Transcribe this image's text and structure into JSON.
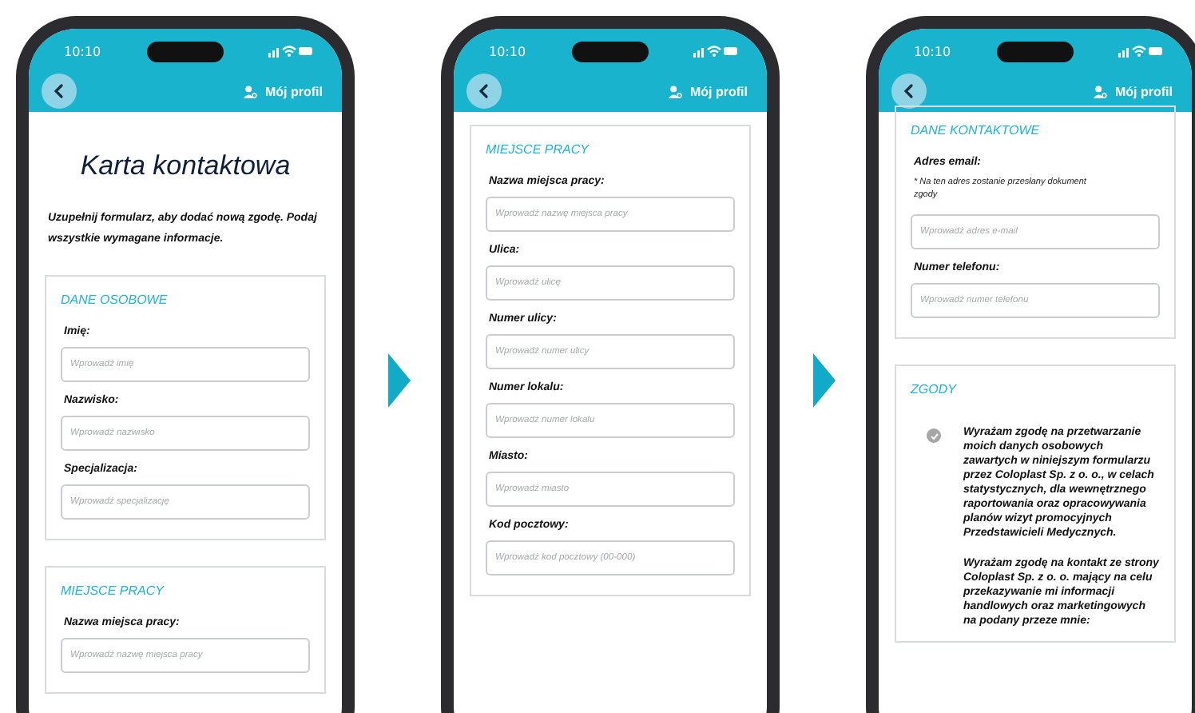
{
  "phones": [
    {
      "status_time": "10:10",
      "profile_label": "Mój profil",
      "title": "Karta kontaktowa",
      "intro": "Uzupełnij formularz, aby dodać nową zgodę. Podaj wszystkie wymagane informacje.",
      "sections": [
        {
          "heading": "DANE OSOBOWE",
          "fields": [
            {
              "label": "Imię:",
              "placeholder": "Wprowadź imię"
            },
            {
              "label": "Nazwisko:",
              "placeholder": "Wprowadź nazwisko"
            },
            {
              "label": "Specjalizacja:",
              "placeholder": "Wprowadź specjalizację"
            }
          ]
        },
        {
          "heading": "MIEJSCE PRACY",
          "fields": [
            {
              "label": "Nazwa miejsca pracy:",
              "placeholder": "Wprowadź nazwę miejsca pracy"
            }
          ]
        }
      ]
    },
    {
      "status_time": "10:10",
      "profile_label": "Mój profil",
      "sections": [
        {
          "heading": "MIEJSCE PRACY",
          "fields": [
            {
              "label": "Nazwa miejsca pracy:",
              "placeholder": "Wprowadź nazwę miejsca pracy"
            },
            {
              "label": "Ulica:",
              "placeholder": "Wprowadź ulicę"
            },
            {
              "label": "Numer ulicy:",
              "placeholder": "Wprowadź numer ulicy"
            },
            {
              "label": "Numer lokalu:",
              "placeholder": "Wprowadź numer lokalu"
            },
            {
              "label": "Miasto:",
              "placeholder": "Wprowadź miasto"
            },
            {
              "label": "Kod pocztowy:",
              "placeholder": "Wprowadź kod pocztowy (00-000)"
            }
          ]
        }
      ]
    },
    {
      "status_time": "10:10",
      "profile_label": "Mój profil",
      "sections": [
        {
          "heading": "DANE KONTAKTOWE",
          "fields": [
            {
              "label": "Adres email:",
              "note": "* Na ten adres zostanie przesłany dokument zgody",
              "placeholder": "Wprowadź adres e-mail"
            },
            {
              "label": "Numer telefonu:",
              "placeholder": "Wprowadź numer telefonu"
            }
          ]
        },
        {
          "heading": "ZGODY",
          "consents": [
            {
              "kind": "checkbox",
              "checked": true,
              "text": "Wyrażam zgodę na przetwarzanie moich danych osobowych zawartych w  niniejszym formularzu przez Coloplast Sp. z o. o., w celach statystycznych, dla  wewnętrznego raportowania oraz opracowywania planów wizyt promocyjnych Przedstawicieli Medycznych."
            },
            {
              "kind": "text",
              "text": "Wyrażam zgodę na kontakt ze strony Coloplast Sp. z o. o. mający na celu  przekazywanie mi informacji handlowych oraz marketingowych na podany  przeze mnie:"
            }
          ]
        }
      ]
    }
  ]
}
